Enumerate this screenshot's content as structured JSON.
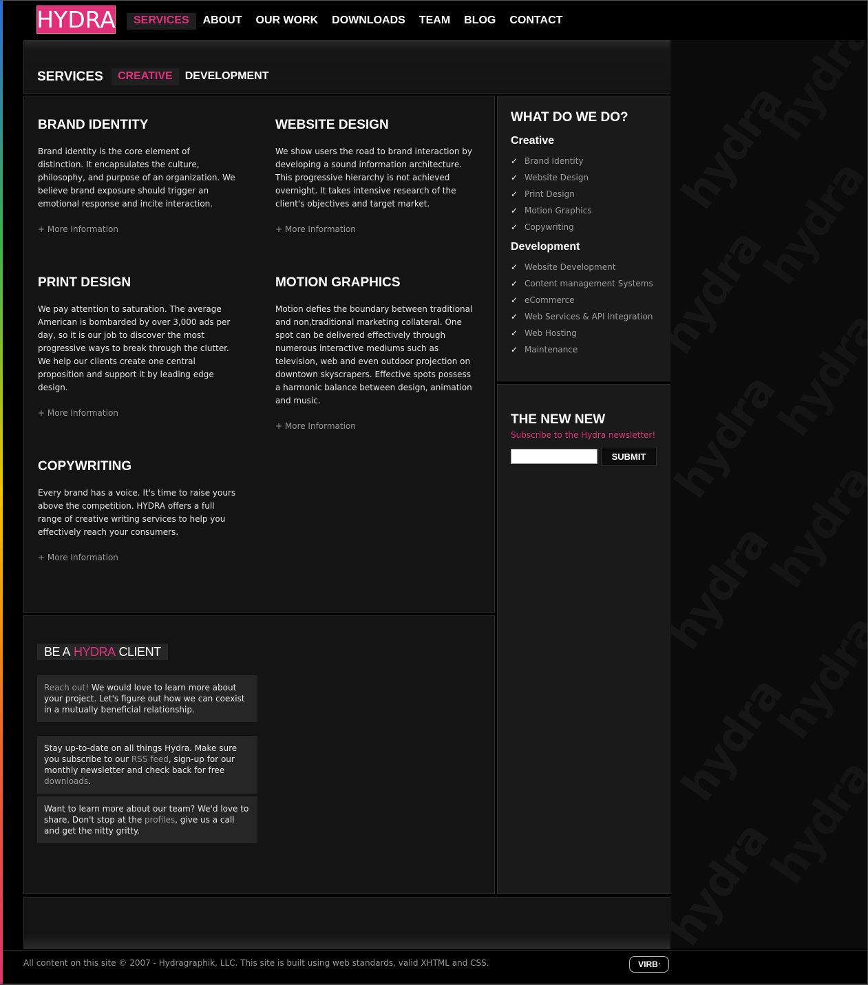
{
  "brand": {
    "logo_text": "HYDRA",
    "accent": "#e0307a"
  },
  "nav": {
    "items": [
      {
        "label": "SERVICES",
        "active": true
      },
      {
        "label": "ABOUT",
        "active": false
      },
      {
        "label": "OUR WORK",
        "active": false
      },
      {
        "label": "DOWNLOADS",
        "active": false
      },
      {
        "label": "TEAM",
        "active": false
      },
      {
        "label": "BLOG",
        "active": false
      },
      {
        "label": "CONTACT",
        "active": false
      }
    ]
  },
  "page": {
    "title": "SERVICES",
    "tabs": [
      {
        "label": "CREATIVE",
        "active": true
      },
      {
        "label": "DEVELOPMENT",
        "active": false
      }
    ]
  },
  "services": [
    {
      "title": "BRAND IDENTITY",
      "body": "Brand identity is the core element of distinction. It encapsulates the culture, philosophy, and purpose of an organization. We believe brand exposure should trigger an emotional response and incite interaction.",
      "more": "+ More Information"
    },
    {
      "title": "WEBSITE DESIGN",
      "body": "We show users the road to brand interaction by developing a sound information architecture. This progressive hierarchy is not achieved overnight. It takes intensive research of the client's objectives and target market.",
      "more": "+ More Information"
    },
    {
      "title": "PRINT DESIGN",
      "body": "We pay attention to saturation. The average American is bombarded by over 3,000 ads per day, so it is our job to discover the most progressive ways to break through the clutter. We help our clients create one central proposition and support it by leading edge design.",
      "more": "+ More Information"
    },
    {
      "title": "MOTION GRAPHICS",
      "body": "Motion defies the boundary between traditional and non,traditional marketing collateral. One spot can be delivered effectively through numerous interactive mediums such as television, web and even outdoor projection on downtown skyscrapers. Effective spots possess a harmonic balance between design, animation and music.",
      "more": "+ More Information"
    },
    {
      "title": "COPYWRITING",
      "body": "Every brand has a voice. It's time to raise yours above the competition. HYDRA offers a full range of creative writing services to help you effectively reach your consumers.",
      "more": "+ More Information"
    }
  ],
  "sidebar": {
    "what_title": "WHAT DO WE DO?",
    "creative_heading": "Creative",
    "creative_items": [
      "Brand Identity",
      "Website Design",
      "Print Design",
      "Motion Graphics",
      "Copywriting"
    ],
    "development_heading": "Development",
    "development_items": [
      "Website Development",
      "Content management Systems",
      "eCommerce",
      "Web Services & API Integration",
      "Web Hosting",
      "Maintenance"
    ],
    "check_glyph": "✓"
  },
  "newsletter": {
    "title": "THE NEW NEW",
    "tagline": "Subscribe to the Hydra newsletter!",
    "email_value": "",
    "submit_label": "SUBMIT"
  },
  "client": {
    "title_pre": "BE A",
    "title_brand": "HYDRA",
    "title_post": "CLIENT",
    "box1": {
      "link": "Reach out!",
      "text": " We would love to learn more about your project. Let's figure out how we can coexist in a mutually beneficial relationship."
    },
    "box2": {
      "text1": "Stay up-to-date on all things Hydra. Make sure you subscribe to our ",
      "link1": "RSS feed",
      "text2": ", sign-up for our monthly newsletter and check back for free ",
      "link2": "downloads",
      "text3": "."
    },
    "box3": {
      "text1": "Want to learn more about our team? We'd love to share. Don't stop at the ",
      "link1": "profiles",
      "text2": ", give us a call and get the nitty gritty."
    }
  },
  "footer": {
    "copyright": "All content on this site © 2007 - Hydragraphik, LLC. This site is built using web standards, valid XHTML and CSS.",
    "badge": "VIRB",
    "badge_mark": "•"
  }
}
